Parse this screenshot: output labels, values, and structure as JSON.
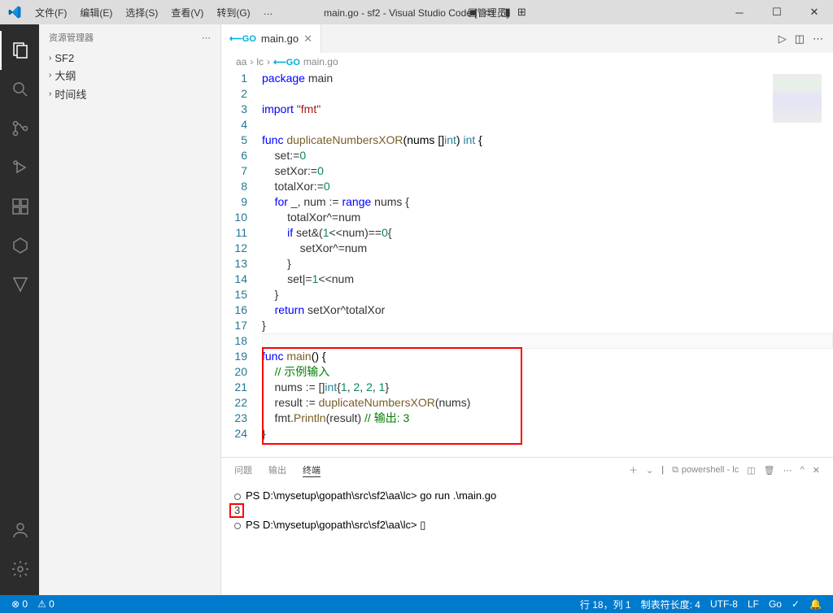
{
  "title": "main.go - sf2 - Visual Studio Code [管理员]",
  "menu": [
    "文件(F)",
    "编辑(E)",
    "选择(S)",
    "查看(V)",
    "转到(G)",
    "…"
  ],
  "sidebar": {
    "header": "资源管理器",
    "items": [
      "SF2",
      "大纲",
      "时间线"
    ]
  },
  "tab": {
    "label": "main.go"
  },
  "breadcrumb": [
    "aa",
    "lc",
    "main.go"
  ],
  "code": {
    "lines": [
      {
        "n": 1,
        "tokens": [
          {
            "t": "package",
            "c": "kw"
          },
          {
            "t": " main",
            "c": ""
          }
        ]
      },
      {
        "n": 2,
        "tokens": []
      },
      {
        "n": 3,
        "tokens": [
          {
            "t": "import",
            "c": "kw"
          },
          {
            "t": " ",
            "c": ""
          },
          {
            "t": "\"fmt\"",
            "c": "str"
          }
        ]
      },
      {
        "n": 4,
        "tokens": []
      },
      {
        "n": 5,
        "tokens": [
          {
            "t": "func",
            "c": "kw"
          },
          {
            "t": " ",
            "c": ""
          },
          {
            "t": "duplicateNumbersXOR",
            "c": "fn"
          },
          {
            "t": "(nums []",
            "c": "pun"
          },
          {
            "t": "int",
            "c": "typ"
          },
          {
            "t": ") ",
            "c": "pun"
          },
          {
            "t": "int",
            "c": "typ"
          },
          {
            "t": " {",
            "c": "pun"
          }
        ]
      },
      {
        "n": 6,
        "tokens": [
          {
            "t": "    set:=",
            "c": ""
          },
          {
            "t": "0",
            "c": "num"
          }
        ]
      },
      {
        "n": 7,
        "tokens": [
          {
            "t": "    setXor:=",
            "c": ""
          },
          {
            "t": "0",
            "c": "num"
          }
        ]
      },
      {
        "n": 8,
        "tokens": [
          {
            "t": "    totalXor:=",
            "c": ""
          },
          {
            "t": "0",
            "c": "num"
          }
        ]
      },
      {
        "n": 9,
        "tokens": [
          {
            "t": "    ",
            "c": ""
          },
          {
            "t": "for",
            "c": "kw"
          },
          {
            "t": " _, num := ",
            "c": ""
          },
          {
            "t": "range",
            "c": "kw"
          },
          {
            "t": " nums {",
            "c": ""
          }
        ]
      },
      {
        "n": 10,
        "tokens": [
          {
            "t": "        totalXor^=num",
            "c": ""
          }
        ]
      },
      {
        "n": 11,
        "tokens": [
          {
            "t": "        ",
            "c": ""
          },
          {
            "t": "if",
            "c": "kw"
          },
          {
            "t": " set&(",
            "c": ""
          },
          {
            "t": "1",
            "c": "num"
          },
          {
            "t": "<<num)==",
            "c": ""
          },
          {
            "t": "0",
            "c": "num"
          },
          {
            "t": "{",
            "c": ""
          }
        ]
      },
      {
        "n": 12,
        "tokens": [
          {
            "t": "            setXor^=num",
            "c": ""
          }
        ]
      },
      {
        "n": 13,
        "tokens": [
          {
            "t": "        }",
            "c": ""
          }
        ]
      },
      {
        "n": 14,
        "tokens": [
          {
            "t": "        set|=",
            "c": ""
          },
          {
            "t": "1",
            "c": "num"
          },
          {
            "t": "<<num",
            "c": ""
          }
        ]
      },
      {
        "n": 15,
        "tokens": [
          {
            "t": "    }",
            "c": ""
          }
        ]
      },
      {
        "n": 16,
        "tokens": [
          {
            "t": "    ",
            "c": ""
          },
          {
            "t": "return",
            "c": "kw"
          },
          {
            "t": " setXor^totalXor",
            "c": ""
          }
        ]
      },
      {
        "n": 17,
        "tokens": [
          {
            "t": "}",
            "c": ""
          }
        ]
      },
      {
        "n": 18,
        "tokens": []
      },
      {
        "n": 19,
        "tokens": [
          {
            "t": "func",
            "c": "kw"
          },
          {
            "t": " ",
            "c": ""
          },
          {
            "t": "main",
            "c": "fn"
          },
          {
            "t": "() {",
            "c": "pun"
          }
        ]
      },
      {
        "n": 20,
        "tokens": [
          {
            "t": "    ",
            "c": ""
          },
          {
            "t": "// 示例输入",
            "c": "com"
          }
        ]
      },
      {
        "n": 21,
        "tokens": [
          {
            "t": "    nums := []",
            "c": ""
          },
          {
            "t": "int",
            "c": "typ"
          },
          {
            "t": "{",
            "c": ""
          },
          {
            "t": "1",
            "c": "num"
          },
          {
            "t": ", ",
            "c": ""
          },
          {
            "t": "2",
            "c": "num"
          },
          {
            "t": ", ",
            "c": ""
          },
          {
            "t": "2",
            "c": "num"
          },
          {
            "t": ", ",
            "c": ""
          },
          {
            "t": "1",
            "c": "num"
          },
          {
            "t": "}",
            "c": ""
          }
        ]
      },
      {
        "n": 22,
        "tokens": [
          {
            "t": "    result := ",
            "c": ""
          },
          {
            "t": "duplicateNumbersXOR",
            "c": "fn"
          },
          {
            "t": "(nums)",
            "c": ""
          }
        ]
      },
      {
        "n": 23,
        "tokens": [
          {
            "t": "    fmt.",
            "c": ""
          },
          {
            "t": "Println",
            "c": "fn"
          },
          {
            "t": "(result) ",
            "c": ""
          },
          {
            "t": "// 输出: 3",
            "c": "com"
          }
        ]
      },
      {
        "n": 24,
        "tokens": [
          {
            "t": "}",
            "c": ""
          }
        ]
      }
    ]
  },
  "panel": {
    "tabs": [
      "问题",
      "输出",
      "终端"
    ],
    "active": 2,
    "shell_label": "powershell - lc",
    "terminal_lines": [
      {
        "prompt": "PS D:\\mysetup\\gopath\\src\\sf2\\aa\\lc>",
        "cmd": " go run .\\main.go"
      },
      {
        "out": "3"
      },
      {
        "prompt": "PS D:\\mysetup\\gopath\\src\\sf2\\aa\\lc>",
        "cmd": " ▯"
      }
    ]
  },
  "statusbar": {
    "left": [
      "⊗ 0",
      "⚠ 0"
    ],
    "right": [
      "行 18，列 1",
      "制表符长度: 4",
      "UTF-8",
      "LF",
      "Go",
      "✓",
      "🔔"
    ]
  }
}
